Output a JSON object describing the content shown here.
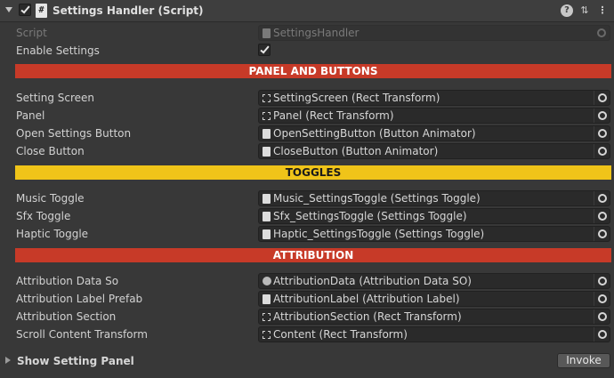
{
  "header": {
    "title": "Settings Handler (Script)",
    "script_icon_glyph": "#",
    "icons": [
      "help-icon",
      "preset-icon",
      "menu-icon"
    ],
    "help_glyph": "?",
    "preset_glyph": "⇅",
    "menu_glyph": "⋮"
  },
  "script_row": {
    "label": "Script",
    "value": "SettingsHandler"
  },
  "enable_row": {
    "label": "Enable Settings",
    "checked": true
  },
  "banners": {
    "panel_and_buttons": "PANEL AND BUTTONS",
    "toggles": "TOGGLES",
    "attribution": "ATTRIBUTION"
  },
  "colors": {
    "red_banner": "#c73a28",
    "yellow_banner": "#f0c419",
    "background": "#383838"
  },
  "panel_fields": [
    {
      "label": "Setting Screen",
      "value": "SettingScreen (Rect Transform)",
      "icon": "rect-transform-icon"
    },
    {
      "label": "Panel",
      "value": "Panel (Rect Transform)",
      "icon": "rect-transform-icon"
    },
    {
      "label": "Open Settings Button",
      "value": "OpenSettingButton (Button Animator)",
      "icon": "script-icon"
    },
    {
      "label": "Close Button",
      "value": "CloseButton (Button Animator)",
      "icon": "script-icon"
    }
  ],
  "toggle_fields": [
    {
      "label": "Music Toggle",
      "value": "Music_SettingsToggle (Settings Toggle)",
      "icon": "script-icon"
    },
    {
      "label": "Sfx Toggle",
      "value": "Sfx_SettingsToggle (Settings Toggle)",
      "icon": "script-icon"
    },
    {
      "label": "Haptic Toggle",
      "value": "Haptic_SettingsToggle (Settings Toggle)",
      "icon": "script-icon"
    }
  ],
  "attribution_fields": [
    {
      "label": "Attribution Data So",
      "value": "AttributionData (Attribution Data SO)",
      "icon": "scriptable-object-icon"
    },
    {
      "label": "Attribution Label Prefab",
      "value": "AttributionLabel (Attribution Label)",
      "icon": "script-icon"
    },
    {
      "label": "Attribution Section",
      "value": "AttributionSection (Rect Transform)",
      "icon": "rect-transform-icon"
    },
    {
      "label": "Scroll Content Transform",
      "value": "Content (Rect Transform)",
      "icon": "rect-transform-icon"
    }
  ],
  "footer": {
    "label": "Show Setting Panel",
    "button": "Invoke"
  }
}
